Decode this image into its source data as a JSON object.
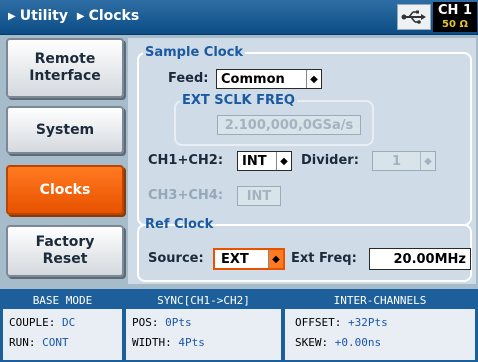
{
  "header": {
    "breadcrumb": [
      "Utility",
      "Clocks"
    ],
    "usb_icon": "usb-icon",
    "channel": "CH 1",
    "impedance": "50 Ω"
  },
  "menu": {
    "items": [
      {
        "line1": "Remote",
        "line2": "Interface"
      },
      {
        "line1": "System",
        "line2": ""
      },
      {
        "line1": "Clocks",
        "line2": ""
      },
      {
        "line1": "Factory",
        "line2": "Reset"
      }
    ],
    "active_index": 2
  },
  "sample_clock": {
    "legend": "Sample Clock",
    "feed_label": "Feed:",
    "feed_value": "Common",
    "ext_legend": "EXT SCLK FREQ",
    "ext_value": "2.100,000,0GSa/s",
    "ch12_label": "CH1+CH2:",
    "ch12_value": "INT",
    "divider_label": "Divider:",
    "divider_value": "1",
    "ch34_label": "CH3+CH4:",
    "ch34_value": "INT"
  },
  "ref_clock": {
    "legend": "Ref Clock",
    "source_label": "Source:",
    "source_value": "EXT",
    "ext_freq_label": "Ext Freq:",
    "ext_freq_value": "20.00MHz"
  },
  "status": {
    "base_mode": {
      "title": "BASE MODE",
      "couple_label": "COUPLE:",
      "couple_value": "DC",
      "run_label": "RUN:",
      "run_value": "CONT"
    },
    "sync": {
      "title": "SYNC[CH1->CH2]",
      "pos_label": "POS:",
      "pos_value": "0Pts",
      "width_label": "WIDTH:",
      "width_value": "4Pts"
    },
    "inter": {
      "title": "INTER-CHANNELS",
      "offset_label": "OFFSET:",
      "offset_value": "+32Pts",
      "skew_label": "SKEW:",
      "skew_value": "+0.00ns"
    }
  },
  "colors": {
    "header_bg": "#0d4d86",
    "accent_orange": "#e85200",
    "panel_bg": "#cfdbe6",
    "label_blue": "#1a5aa0"
  }
}
